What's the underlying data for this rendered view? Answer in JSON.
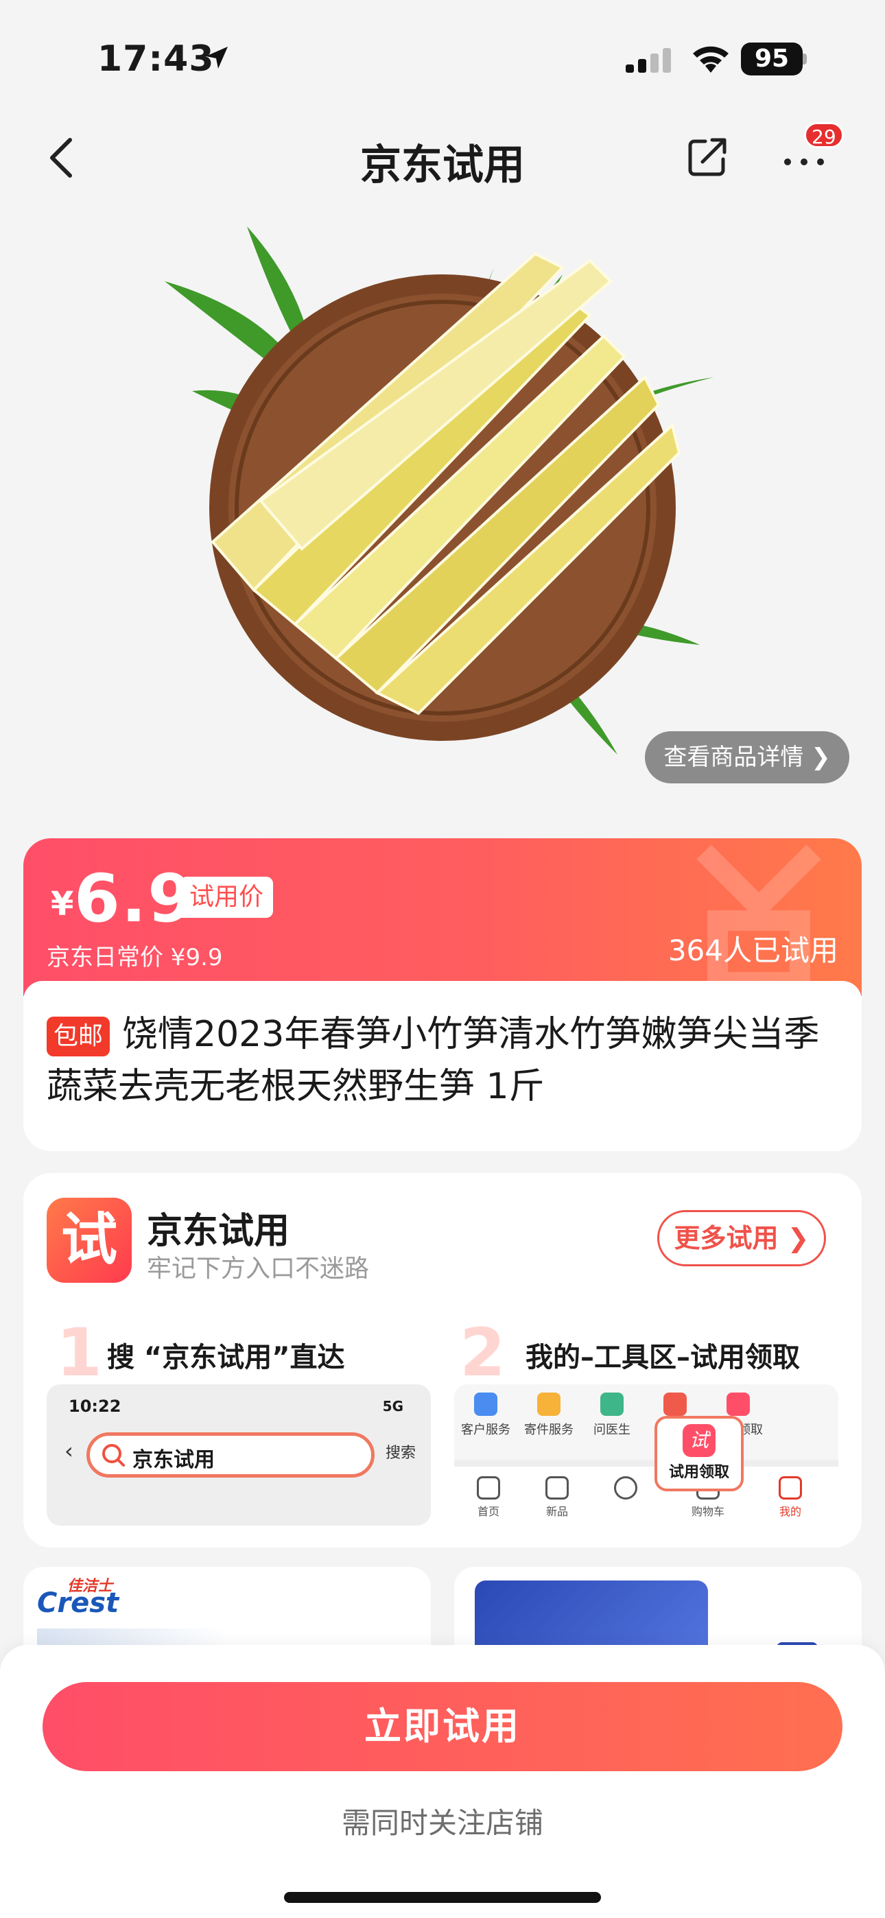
{
  "status_bar": {
    "time": "17:43",
    "battery": "95"
  },
  "nav": {
    "title": "京东试用",
    "more_badge": "29"
  },
  "hero": {
    "detail_link": "查看商品详情 ❯"
  },
  "price": {
    "currency": "¥",
    "value": "6.9",
    "tag": "试用价",
    "daily_price": "京东日常价 ¥9.9",
    "tried_count": "364人已试用"
  },
  "product": {
    "badge": "包邮",
    "title": "饶情2023年春笋小竹笋清水竹笋嫩笋尖当季蔬菜去壳无老根天然野生笋 1斤"
  },
  "entry": {
    "logo_char": "试",
    "title": "京东试用",
    "subtitle": "牢记下方入口不迷路",
    "more_button": "更多试用 ❯",
    "steps": [
      {
        "num": "1",
        "text": "搜 “京东试用”直达"
      },
      {
        "num": "2",
        "text": "我的–工具区–试用领取"
      }
    ],
    "mock_search": {
      "time": "10:22",
      "network": "5G",
      "query": "京东试用",
      "search_btn": "搜索"
    },
    "mock_tools": {
      "items": [
        "客户服务",
        "寄件服务",
        "问医生",
        "",
        "试用领取"
      ],
      "tabs": [
        "首页",
        "新品",
        "",
        "购物车",
        "我的"
      ],
      "popup_icon": "试",
      "popup_label": "试用领取"
    }
  },
  "recommend": {
    "brand_en": "Crest",
    "brand_cn": "佳洁士"
  },
  "bottom": {
    "cta": "立即试用",
    "note": "需同时关注店铺"
  },
  "colors": {
    "accent": "#ff4f68",
    "accent_orange": "#ff7a4a",
    "background": "#f4f4f4"
  }
}
